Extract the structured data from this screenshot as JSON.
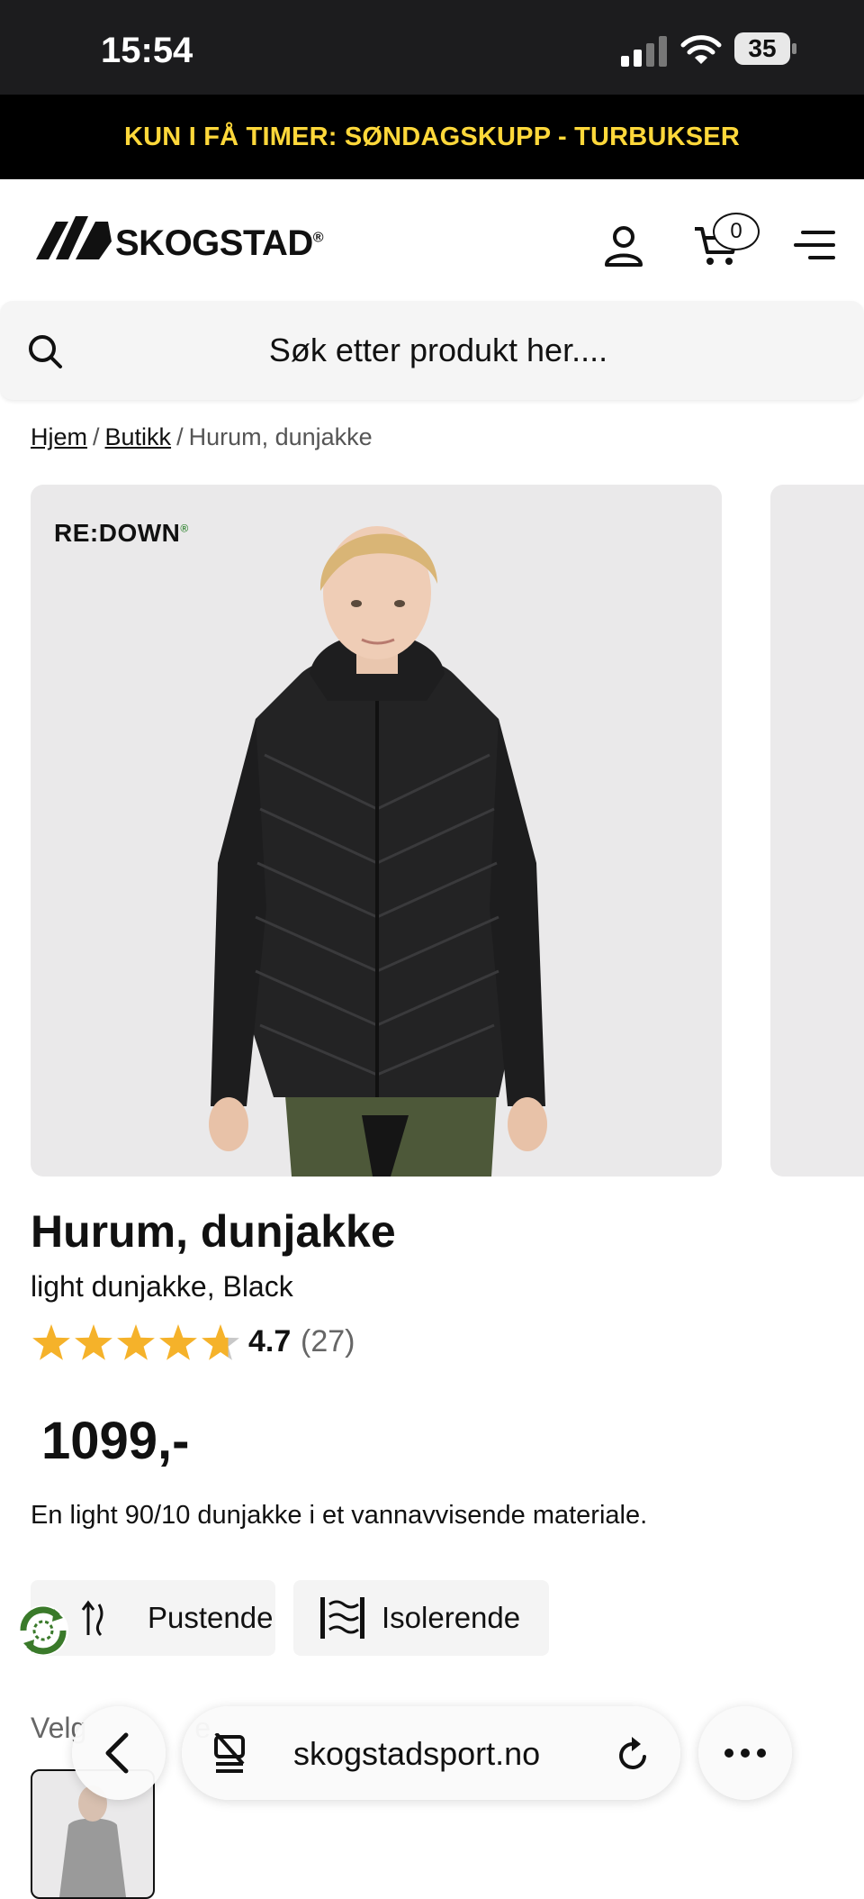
{
  "status_bar": {
    "time": "15:54",
    "battery": "35"
  },
  "promo": {
    "text": "KUN I FÅ TIMER: SØNDAGSKUPP - TURBUKSER"
  },
  "header": {
    "brand": "SKOGSTAD",
    "cart_count": "0"
  },
  "search": {
    "placeholder": "Søk etter produkt her...."
  },
  "breadcrumb": {
    "home": "Hjem",
    "shop": "Butikk",
    "current": "Hurum, dunjakke"
  },
  "gallery": {
    "badge": "RE:DOWN"
  },
  "product": {
    "title": "Hurum, dunjakke",
    "subtitle": "light dunjakke, Black",
    "rating": "4.7",
    "rating_value": 4.7,
    "review_count": "(27)",
    "price": "1099,-",
    "description": "En light 90/10 dunjakke i et vannavvisende materiale.",
    "features": [
      "Pustende",
      "Isolerende"
    ],
    "size_label": "Velg",
    "size_label_tail": "e"
  },
  "browser": {
    "url": "skogstadsport.no"
  },
  "colors": {
    "promo_text": "#ffd83a",
    "star": "#f5b22a",
    "star_empty": "#c8c8c8",
    "eco_green": "#3a7a2a"
  }
}
